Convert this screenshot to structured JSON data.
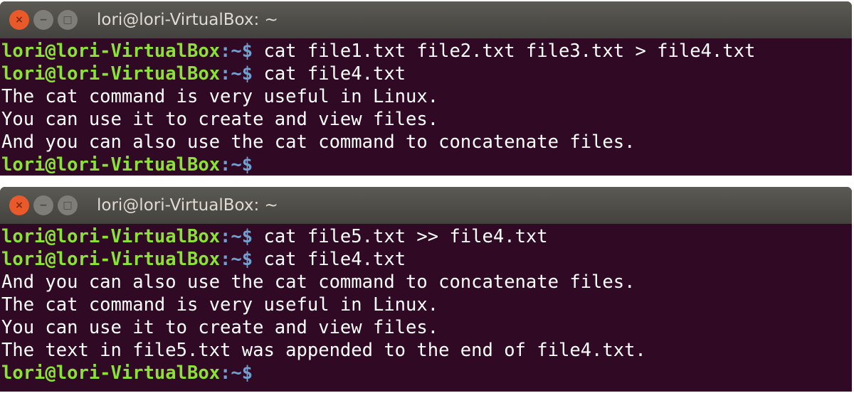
{
  "colors": {
    "background": "#300a24",
    "prompt_user": "#8ae234",
    "prompt_path": "#729fcf",
    "text": "#ffffff",
    "titlebar": "#4d4c48",
    "close_button": "#e9592a"
  },
  "windows": [
    {
      "title": "lori@lori-VirtualBox: ~",
      "buttons": {
        "close": "×",
        "minimize": "−",
        "maximize": "□"
      },
      "lines": [
        {
          "type": "prompt",
          "user": "lori@lori-VirtualBox",
          "path": ":~$",
          "command": " cat file1.txt file2.txt file3.txt > file4.txt"
        },
        {
          "type": "prompt",
          "user": "lori@lori-VirtualBox",
          "path": ":~$",
          "command": " cat file4.txt"
        },
        {
          "type": "output",
          "text": "The cat command is very useful in Linux."
        },
        {
          "type": "output",
          "text": "You can use it to create and view files."
        },
        {
          "type": "output",
          "text": "And you can also use the cat command to concatenate files."
        },
        {
          "type": "prompt",
          "user": "lori@lori-VirtualBox",
          "path": ":~$",
          "command": ""
        }
      ]
    },
    {
      "title": "lori@lori-VirtualBox: ~",
      "buttons": {
        "close": "×",
        "minimize": "−",
        "maximize": "□"
      },
      "lines": [
        {
          "type": "prompt",
          "user": "lori@lori-VirtualBox",
          "path": ":~$",
          "command": " cat file5.txt >> file4.txt"
        },
        {
          "type": "prompt",
          "user": "lori@lori-VirtualBox",
          "path": ":~$",
          "command": " cat file4.txt"
        },
        {
          "type": "output",
          "text": "And you can also use the cat command to concatenate files."
        },
        {
          "type": "output",
          "text": "The cat command is very useful in Linux."
        },
        {
          "type": "output",
          "text": "You can use it to create and view files."
        },
        {
          "type": "output",
          "text": "The text in file5.txt was appended to the end of file4.txt."
        },
        {
          "type": "prompt",
          "user": "lori@lori-VirtualBox",
          "path": ":~$",
          "command": ""
        }
      ]
    }
  ]
}
